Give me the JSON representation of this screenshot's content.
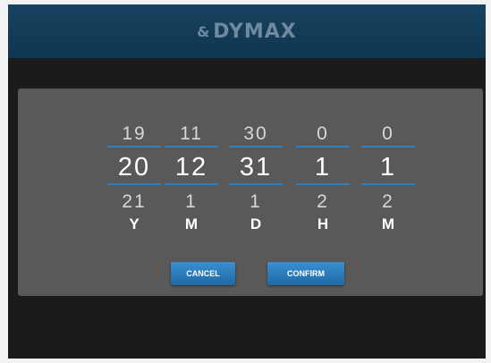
{
  "header": {
    "logo_text": "DYMAX",
    "logo_mark": "&",
    "bg_color": "#17425f"
  },
  "picker": {
    "columns": [
      {
        "prev": "19",
        "current": "20",
        "next": "21",
        "unit": "Y"
      },
      {
        "prev": "11",
        "current": "12",
        "next": "1",
        "unit": "M"
      },
      {
        "prev": "30",
        "current": "31",
        "next": "1",
        "unit": "D"
      },
      {
        "prev": "0",
        "current": "1",
        "next": "2",
        "unit": "H"
      },
      {
        "prev": "0",
        "current": "1",
        "next": "2",
        "unit": "M"
      }
    ],
    "accent_color": "#2e7fbf"
  },
  "buttons": {
    "cancel_label": "CANCEL",
    "confirm_label": "CONFIRM"
  }
}
